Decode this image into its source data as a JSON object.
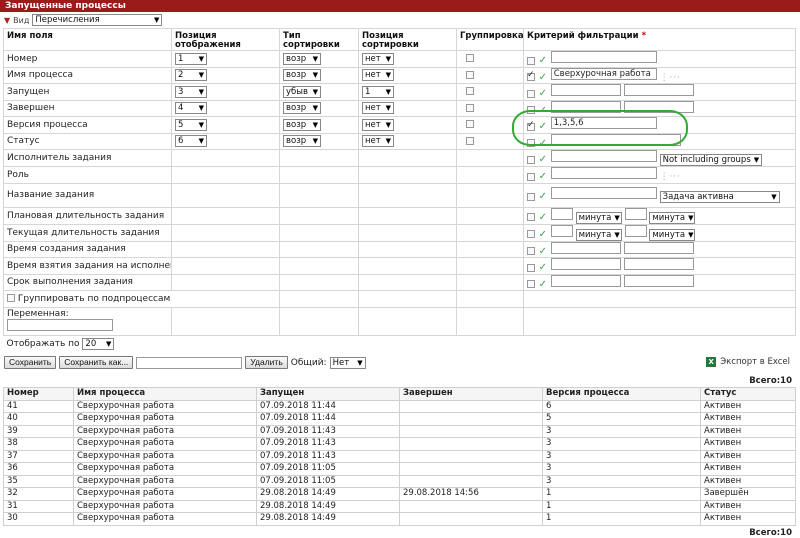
{
  "title": "Запущенные процессы",
  "view": {
    "label": "Вид",
    "value": "Перечисления"
  },
  "headers": {
    "field": "Имя поля",
    "position": "Позиция отображения",
    "sort_type": "Тип сортировки",
    "sort_position": "Позиция сортировки",
    "group": "Группировка",
    "filter": "Критерий фильтрации",
    "required_mark": "*"
  },
  "rows": [
    {
      "name": "Номер",
      "pos": "1",
      "sort": "возр",
      "sortpos": "нет",
      "filter_checked": false,
      "filter_text": ""
    },
    {
      "name": "Имя процесса",
      "pos": "2",
      "sort": "возр",
      "sortpos": "нет",
      "filter_checked": true,
      "filter_text": "Сверхурочная работа"
    },
    {
      "name": "Запущен",
      "pos": "3",
      "sort": "убыв",
      "sortpos": "1",
      "filter_checked": false,
      "filter_text": ""
    },
    {
      "name": "Завершен",
      "pos": "4",
      "sort": "возр",
      "sortpos": "нет",
      "filter_checked": false,
      "filter_text": ""
    },
    {
      "name": "Версия процесса",
      "pos": "5",
      "sort": "возр",
      "sortpos": "нет",
      "filter_checked": true,
      "filter_text": "1,3,5,6"
    },
    {
      "name": "Статус",
      "pos": "6",
      "sort": "возр",
      "sortpos": "нет",
      "filter_checked": false,
      "filter_text": ""
    }
  ],
  "extra_rows": {
    "executor": "Исполнитель задания",
    "executor_option": "Not including groups",
    "role": "Роль",
    "task_name": "Название задания",
    "task_status_option": "Задача активна",
    "planned_duration": "Плановая длительность задания",
    "current_duration": "Текущая длительность задания",
    "unit_minute": "минута",
    "created": "Время создания задания",
    "taken": "Время взятия задания на исполнение",
    "deadline": "Срок выполнения задания",
    "group_by_sub": "Группировать по подпроцессам",
    "variable": "Переменная:"
  },
  "display_per": {
    "label": "Отображать по",
    "value": "20"
  },
  "buttons": {
    "save": "Сохранить",
    "save_as": "Сохранить как...",
    "delete": "Удалить",
    "shared_label": "Общий:",
    "shared_value": "Нет",
    "excel": "Экспорт в Excel"
  },
  "total": "Всего:10",
  "results": {
    "columns": [
      "Номер",
      "Имя процесса",
      "Запущен",
      "Завершен",
      "Версия процесса",
      "Статус"
    ],
    "rows": [
      [
        "41",
        "Сверхурочная работа",
        "07.09.2018 11:44",
        "",
        "6",
        "Активен"
      ],
      [
        "40",
        "Сверхурочная работа",
        "07.09.2018 11:44",
        "",
        "5",
        "Активен"
      ],
      [
        "39",
        "Сверхурочная работа",
        "07.09.2018 11:43",
        "",
        "3",
        "Активен"
      ],
      [
        "38",
        "Сверхурочная работа",
        "07.09.2018 11:43",
        "",
        "3",
        "Активен"
      ],
      [
        "37",
        "Сверхурочная работа",
        "07.09.2018 11:43",
        "",
        "3",
        "Активен"
      ],
      [
        "36",
        "Сверхурочная работа",
        "07.09.2018 11:05",
        "",
        "3",
        "Активен"
      ],
      [
        "35",
        "Сверхурочная работа",
        "07.09.2018 11:05",
        "",
        "3",
        "Активен"
      ],
      [
        "32",
        "Сверхурочная работа",
        "29.08.2018 14:49",
        "29.08.2018 14:56",
        "1",
        "Завершён"
      ],
      [
        "31",
        "Сверхурочная работа",
        "29.08.2018 14:49",
        "",
        "1",
        "Активен"
      ],
      [
        "30",
        "Сверхурочная работа",
        "29.08.2018 14:49",
        "",
        "1",
        "Активен"
      ]
    ]
  },
  "colors": {
    "titlebar": "#9b1a1a",
    "annotation": "#33aa33",
    "tick": "#3aa34a"
  }
}
